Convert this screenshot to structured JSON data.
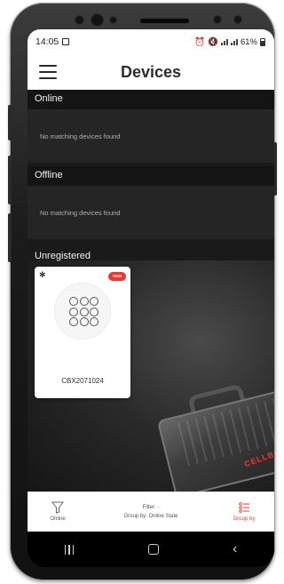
{
  "status_bar": {
    "time": "14:05",
    "battery_percent": "61%"
  },
  "header": {
    "title": "Devices"
  },
  "sections": [
    {
      "title": "Online",
      "empty_message": "No matching devices found"
    },
    {
      "title": "Offline",
      "empty_message": "No matching devices found"
    },
    {
      "title": "Unregistered"
    }
  ],
  "device_card": {
    "badge": "new",
    "device_id": "CBX2071024",
    "icon": "keypad-icon",
    "connection_icon": "bluetooth-icon"
  },
  "background_art": {
    "logo_text": "CELLBOX"
  },
  "bottom_bar": {
    "left_label": "Online",
    "filter_text": "Filter: -",
    "group_text": "Group by: Online State",
    "right_label": "Group by"
  },
  "colors": {
    "accent": "#e53935",
    "content_bg": "#1a1a1a",
    "section_header_bg": "#141414",
    "section_body_bg": "#252525"
  }
}
